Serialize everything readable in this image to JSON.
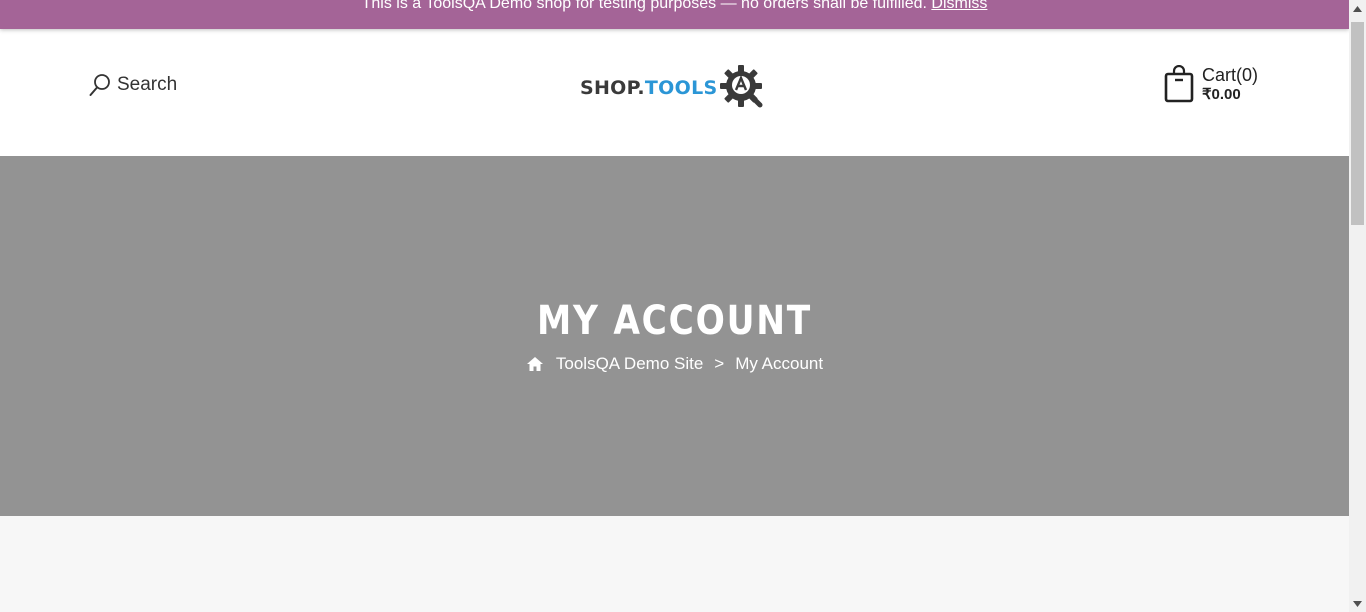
{
  "notice": {
    "text": "This is a ToolsQA Demo shop for testing purposes — no orders shall be fulfilled.",
    "dismiss_label": "Dismiss",
    "color": "#a46497"
  },
  "header": {
    "search_label": "Search",
    "search_icon": "search-icon",
    "logo": {
      "part1": "SHOP.",
      "part2": "TOOLS",
      "gear_letter": "A"
    },
    "cart": {
      "label": "Cart(0)",
      "total": "₹0.00",
      "icon": "shopping-bag-icon"
    }
  },
  "hero": {
    "title": "MY ACCOUNT",
    "breadcrumb": {
      "home_icon": "home-icon",
      "site": "ToolsQA Demo Site",
      "separator": ">",
      "current": "My Account"
    },
    "background": "#939393"
  }
}
